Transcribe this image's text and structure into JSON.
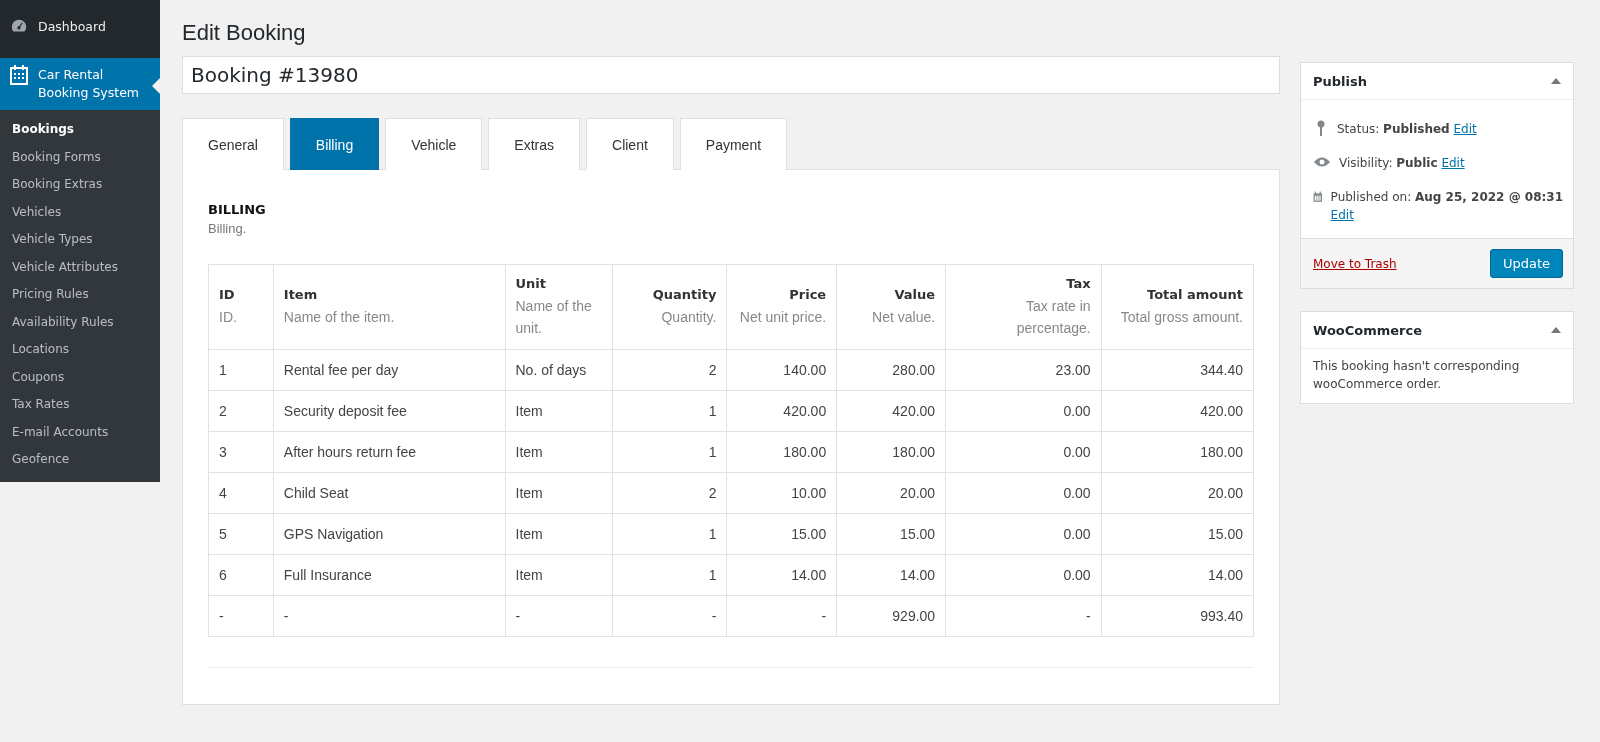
{
  "sidebar": {
    "items": [
      {
        "label": "Dashboard",
        "selected": false
      },
      {
        "label": "Car Rental Booking System",
        "selected": true,
        "children": [
          {
            "label": "Bookings",
            "selected": true
          },
          {
            "label": "Booking Forms",
            "selected": false
          },
          {
            "label": "Booking Extras",
            "selected": false
          },
          {
            "label": "Vehicles",
            "selected": false
          },
          {
            "label": "Vehicle Types",
            "selected": false
          },
          {
            "label": "Vehicle Attributes",
            "selected": false
          },
          {
            "label": "Pricing Rules",
            "selected": false
          },
          {
            "label": "Availability Rules",
            "selected": false
          },
          {
            "label": "Locations",
            "selected": false
          },
          {
            "label": "Coupons",
            "selected": false
          },
          {
            "label": "Tax Rates",
            "selected": false
          },
          {
            "label": "E-mail Accounts",
            "selected": false
          },
          {
            "label": "Geofence",
            "selected": false
          }
        ]
      }
    ]
  },
  "page_title": "Edit Booking",
  "title_field": {
    "value": "Booking #13980"
  },
  "tabs": [
    {
      "label": "General",
      "selected": false
    },
    {
      "label": "Billing",
      "selected": true
    },
    {
      "label": "Vehicle",
      "selected": false
    },
    {
      "label": "Extras",
      "selected": false
    },
    {
      "label": "Client",
      "selected": false
    },
    {
      "label": "Payment",
      "selected": false
    }
  ],
  "section": {
    "heading": "BILLING",
    "description": "Billing."
  },
  "table": {
    "columns": [
      {
        "title": "ID",
        "description": "ID."
      },
      {
        "title": "Item",
        "description": "Name of the item."
      },
      {
        "title": "Unit",
        "description": "Name of the unit."
      },
      {
        "title": "Quantity",
        "description": "Quantity."
      },
      {
        "title": "Price",
        "description": "Net unit price."
      },
      {
        "title": "Value",
        "description": "Net value."
      },
      {
        "title": "Tax",
        "description": "Tax rate in percentage."
      },
      {
        "title": "Total amount",
        "description": "Total gross amount."
      }
    ],
    "rows": [
      [
        "1",
        "Rental fee per day",
        "No. of days",
        "2",
        "140.00",
        "280.00",
        "23.00",
        "344.40"
      ],
      [
        "2",
        "Security deposit fee",
        "Item",
        "1",
        "420.00",
        "420.00",
        "0.00",
        "420.00"
      ],
      [
        "3",
        "After hours return fee",
        "Item",
        "1",
        "180.00",
        "180.00",
        "0.00",
        "180.00"
      ],
      [
        "4",
        "Child Seat",
        "Item",
        "2",
        "10.00",
        "20.00",
        "0.00",
        "20.00"
      ],
      [
        "5",
        "GPS Navigation",
        "Item",
        "1",
        "15.00",
        "15.00",
        "0.00",
        "15.00"
      ],
      [
        "6",
        "Full Insurance",
        "Item",
        "1",
        "14.00",
        "14.00",
        "0.00",
        "14.00"
      ],
      [
        "-",
        "-",
        "-",
        "-",
        "-",
        "929.00",
        "-",
        "993.40"
      ]
    ]
  },
  "publish": {
    "title": "Publish",
    "rows": [
      {
        "text": "Status: **Published**",
        "link": "Edit"
      },
      {
        "text": "Visibility: **Public**",
        "link": "Edit"
      },
      {
        "text": "Published on: **Aug 25, 2022 @ 08:31**",
        "link": "Edit"
      }
    ],
    "trash": "Move to Trash",
    "button": "Update"
  },
  "woocommerce": {
    "title": "WooCommerce",
    "text": "This booking hasn't corresponding wooCommerce order."
  }
}
